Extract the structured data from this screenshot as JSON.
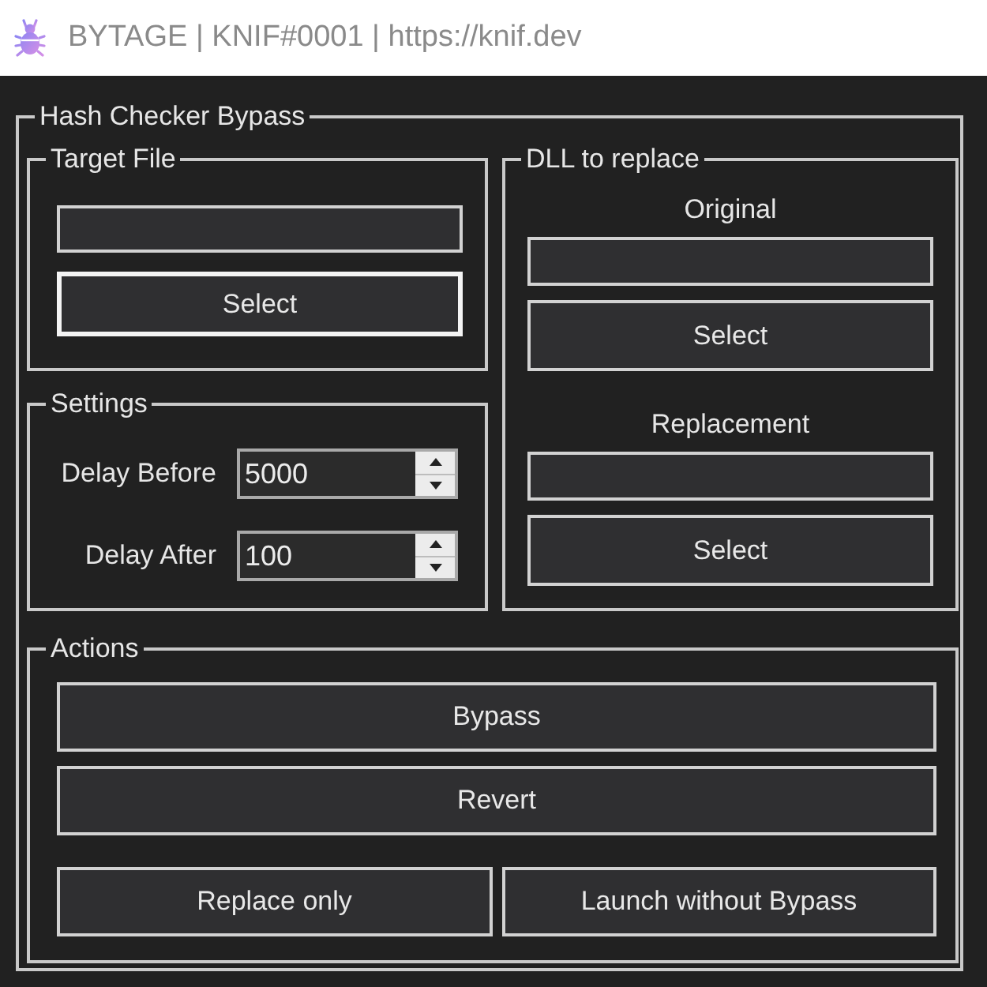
{
  "window": {
    "title": "BYTAGE | KNIF#0001 | https://knif.dev"
  },
  "main_group": {
    "title": "Hash Checker Bypass",
    "target_file": {
      "title": "Target File",
      "select_button": {
        "label": "Select",
        "focused": true
      }
    },
    "settings": {
      "title": "Settings",
      "rows": [
        {
          "label": "Delay Before",
          "value": "5000"
        },
        {
          "label": "Delay After",
          "value": "100"
        }
      ]
    },
    "dll_to_replace": {
      "title": "DLL to replace",
      "slots": [
        {
          "label": "Original",
          "select_button": {
            "label": "Select",
            "focused": false
          }
        },
        {
          "label": "Replacement",
          "select_button": {
            "label": "Select",
            "focused": false
          }
        }
      ]
    },
    "actions": {
      "title": "Actions",
      "rows": [
        {
          "buttons": [
            {
              "label": "Bypass",
              "focused": false
            }
          ]
        },
        {
          "buttons": [
            {
              "label": "Revert",
              "focused": false
            }
          ]
        },
        {
          "buttons": [
            {
              "label": "Replace only",
              "focused": false
            },
            {
              "label": "Launch without Bypass",
              "focused": false
            }
          ]
        }
      ]
    }
  }
}
